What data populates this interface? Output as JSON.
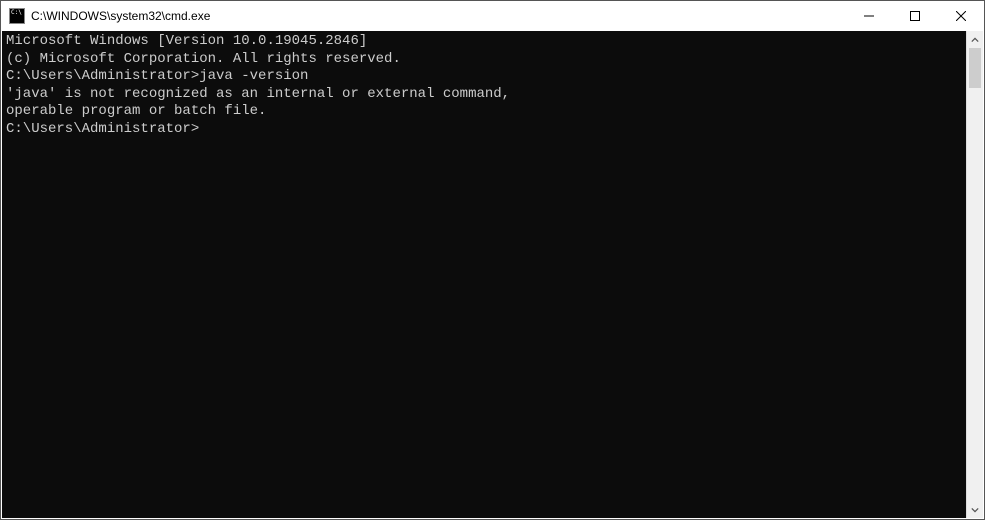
{
  "titlebar": {
    "title": "C:\\WINDOWS\\system32\\cmd.exe"
  },
  "terminal": {
    "lines": [
      "Microsoft Windows [Version 10.0.19045.2846]",
      "(c) Microsoft Corporation. All rights reserved.",
      "",
      "C:\\Users\\Administrator>java -version",
      "'java' is not recognized as an internal or external command,",
      "operable program or batch file.",
      "",
      "C:\\Users\\Administrator>"
    ]
  }
}
